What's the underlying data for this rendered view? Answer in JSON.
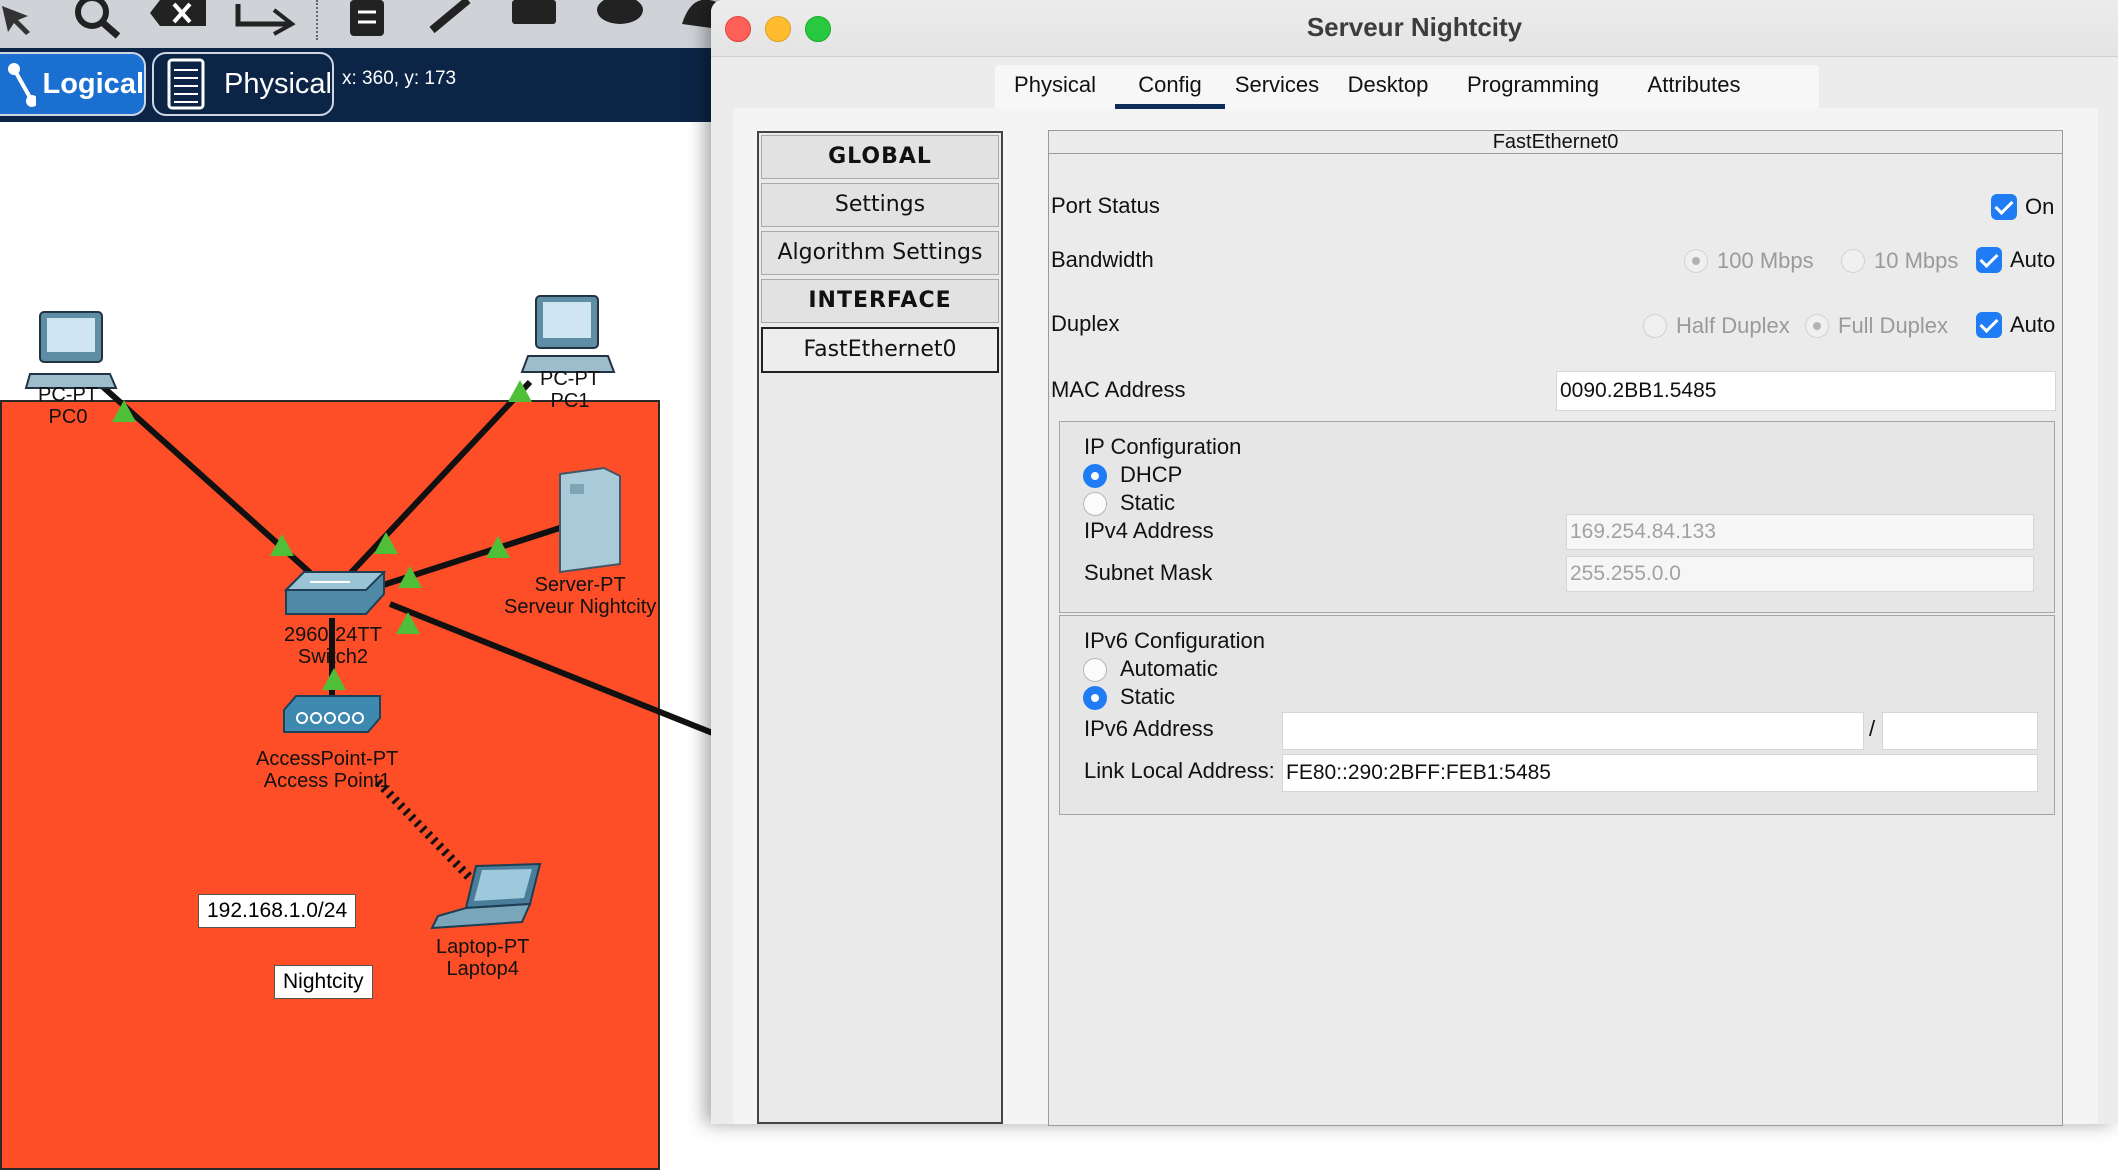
{
  "toolbar": {
    "icons": [
      "select-arrow-icon",
      "magnifier-icon",
      "delete-icon",
      "resize-icon",
      "note-icon",
      "pencil-icon",
      "rectangle-icon",
      "ellipse-icon",
      "freeform-icon"
    ]
  },
  "viewbar": {
    "logical_label": "Logical",
    "physical_label": "Physical",
    "coordinates": "x: 360, y: 173"
  },
  "topology": {
    "devices": [
      {
        "type": "PC-PT",
        "name": "PC0"
      },
      {
        "type": "PC-PT",
        "name": "PC1"
      },
      {
        "type": "Server-PT",
        "name": "Serveur Nightcity"
      },
      {
        "type": "2960-24TT",
        "name": "Switch2"
      },
      {
        "type": "AccessPoint-PT",
        "name": "Access Point1"
      },
      {
        "type": "Laptop-PT",
        "name": "Laptop4"
      }
    ],
    "notes": [
      "192.168.1.0/24",
      "Nightcity"
    ],
    "cluster_color": "#fd4e27"
  },
  "window": {
    "title": "Serveur Nightcity",
    "tabs": [
      "Physical",
      "Config",
      "Services",
      "Desktop",
      "Programming",
      "Attributes"
    ],
    "active_tab": "Config",
    "sidebar": [
      "GLOBAL",
      "Settings",
      "Algorithm Settings",
      "INTERFACE",
      "FastEthernet0"
    ],
    "selected_sidebar": "FastEthernet0"
  },
  "interface": {
    "header": "FastEthernet0",
    "port_status": {
      "label": "Port Status",
      "on_label": "On",
      "on_checked": true
    },
    "bandwidth": {
      "label": "Bandwidth",
      "options": [
        "100 Mbps",
        "10 Mbps"
      ],
      "auto_label": "Auto",
      "auto_checked": true
    },
    "duplex": {
      "label": "Duplex",
      "options": [
        "Half Duplex",
        "Full Duplex"
      ],
      "auto_label": "Auto",
      "auto_checked": true
    },
    "mac": {
      "label": "MAC Address",
      "value": "0090.2BB1.5485"
    },
    "ipv4": {
      "title": "IP Configuration",
      "dhcp_label": "DHCP",
      "static_label": "Static",
      "mode": "DHCP",
      "address_label": "IPv4 Address",
      "address_value": "169.254.84.133",
      "mask_label": "Subnet Mask",
      "mask_value": "255.255.0.0"
    },
    "ipv6": {
      "title": "IPv6 Configuration",
      "automatic_label": "Automatic",
      "static_label": "Static",
      "mode": "Static",
      "address_label": "IPv6 Address",
      "address_value": "",
      "prefix_separator": "/",
      "prefix_value": "",
      "link_local_label": "Link Local Address:",
      "link_local_value": "FE80::290:2BFF:FEB1:5485"
    }
  },
  "colors": {
    "accent": "#1f7cf4",
    "viewbar": "#0c2546",
    "logical_button": "#1a6fd0"
  }
}
